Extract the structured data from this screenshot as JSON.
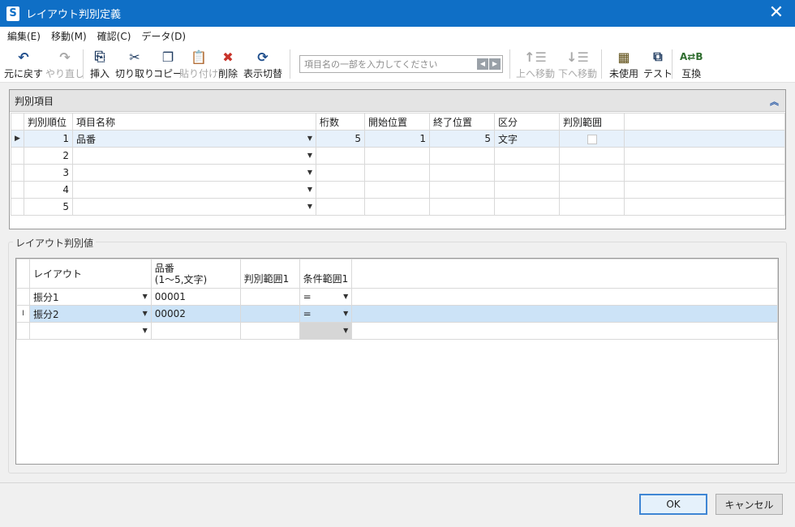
{
  "window": {
    "title": "レイアウト判別定義",
    "app_letter": "S",
    "close": "✕"
  },
  "menu": [
    "編集(E)",
    "移動(M)",
    "確認(C)",
    "データ(D)"
  ],
  "toolbar": {
    "undo": "元に戻す",
    "redo": "やり直し",
    "insert": "挿入",
    "cut": "切り取り",
    "copy": "コピー",
    "paste": "貼り付け",
    "delete": "削除",
    "toggle": "表示切替",
    "search_placeholder": "項目名の一部を入力してください",
    "move_up": "上へ移動",
    "move_down": "下へ移動",
    "unused": "未使用",
    "test": "テスト",
    "swap": "互換"
  },
  "panel1": {
    "title": "判別項目",
    "headers": [
      "判別順位",
      "項目名称",
      "桁数",
      "開始位置",
      "終了位置",
      "区分",
      "判別範囲"
    ],
    "rows": [
      {
        "order": "1",
        "name": "品番",
        "digits": "5",
        "start": "1",
        "end": "5",
        "kind": "文字"
      },
      {
        "order": "2",
        "name": "",
        "digits": "",
        "start": "",
        "end": "",
        "kind": ""
      },
      {
        "order": "3",
        "name": "",
        "digits": "",
        "start": "",
        "end": "",
        "kind": ""
      },
      {
        "order": "4",
        "name": "",
        "digits": "",
        "start": "",
        "end": "",
        "kind": ""
      },
      {
        "order": "5",
        "name": "",
        "digits": "",
        "start": "",
        "end": "",
        "kind": ""
      }
    ]
  },
  "panel2": {
    "title": "レイアウト判別値",
    "headers": {
      "layout": "レイアウト",
      "item_line1": "品番",
      "item_line2": "(1〜5,文字)",
      "range": "判別範囲1",
      "condition": "条件範囲1"
    },
    "rows": [
      {
        "layout": "振分1",
        "value": "00001",
        "range": "",
        "cond": "="
      },
      {
        "layout": "振分2",
        "value": "00002",
        "range": "",
        "cond": "="
      },
      {
        "layout": "",
        "value": "",
        "range": "",
        "cond": ""
      }
    ]
  },
  "buttons": {
    "ok": "OK",
    "cancel": "キャンセル"
  }
}
